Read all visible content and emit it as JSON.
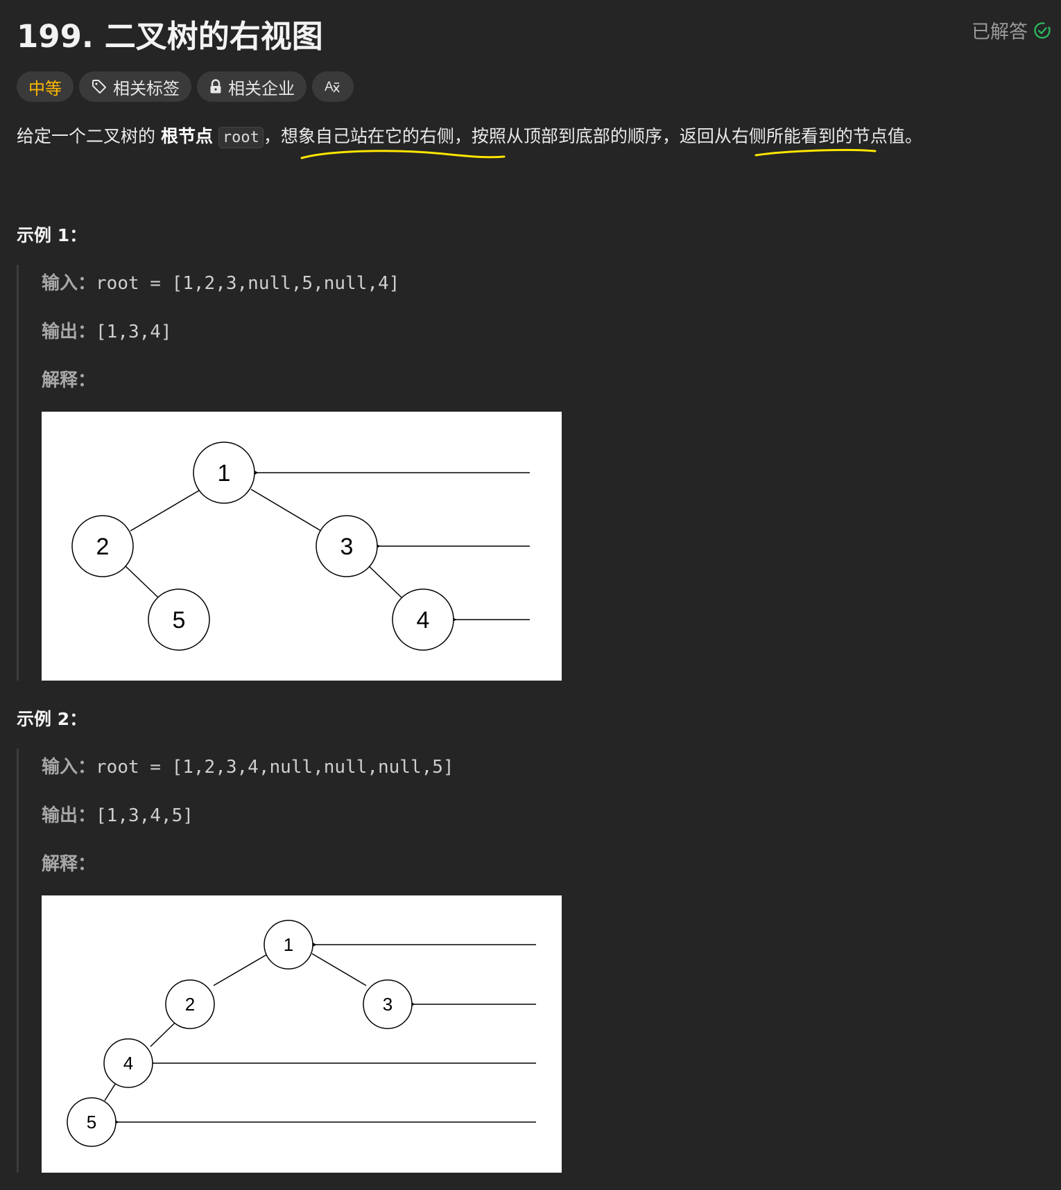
{
  "problem": {
    "title": "199. 二叉树的右视图",
    "status_label": "已解答",
    "tags": {
      "difficulty": "中等",
      "related_tags": "相关标签",
      "related_companies": "相关企业",
      "translate_glyph": "Aͯ"
    },
    "description": {
      "part1": "给定一个二叉树的 ",
      "bold": "根节点",
      "code": "root",
      "part2": "，想象自己站在它的右侧，按照从顶部到底部的顺序，返回从右侧所能看到的节点值。"
    }
  },
  "examples": [
    {
      "title": "示例 1：",
      "input_label": "输入：",
      "input_value": "root = [1,2,3,null,5,null,4]",
      "output_label": "输出：",
      "output_value": "[1,3,4]",
      "explain_label": "解释：",
      "nodes": [
        "1",
        "2",
        "3",
        "5",
        "4"
      ]
    },
    {
      "title": "示例 2：",
      "input_label": "输入：",
      "input_value": "root = [1,2,3,4,null,null,null,5]",
      "output_label": "输出：",
      "output_value": "[1,3,4,5]",
      "explain_label": "解释：",
      "nodes": [
        "1",
        "2",
        "3",
        "4",
        "5"
      ]
    }
  ],
  "colors": {
    "background": "#252525",
    "difficulty": "#ffb800",
    "solved_check": "#2db55d",
    "highlight_underline": "#ffe600"
  }
}
